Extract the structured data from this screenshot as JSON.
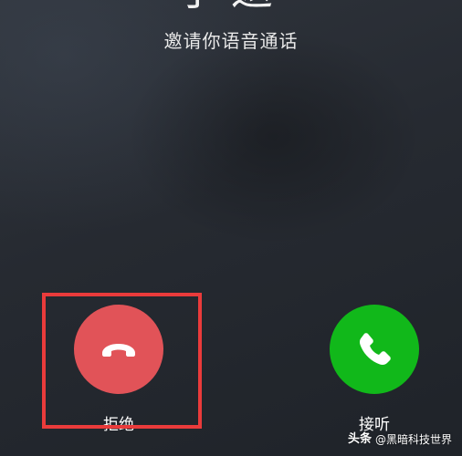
{
  "caller": {
    "name_partial": "子返",
    "subtitle": "邀请你语音通话"
  },
  "actions": {
    "decline_label": "拒绝",
    "accept_label": "接听"
  },
  "watermark": {
    "brand": "头条",
    "handle": "@黑暗科技世界"
  },
  "icons": {
    "decline": "phone-hangup-icon",
    "accept": "phone-icon"
  },
  "colors": {
    "decline_button": "#e15358",
    "accept_button": "#11b81a",
    "highlight_border": "#ea3b3b",
    "background": "#262a31"
  }
}
